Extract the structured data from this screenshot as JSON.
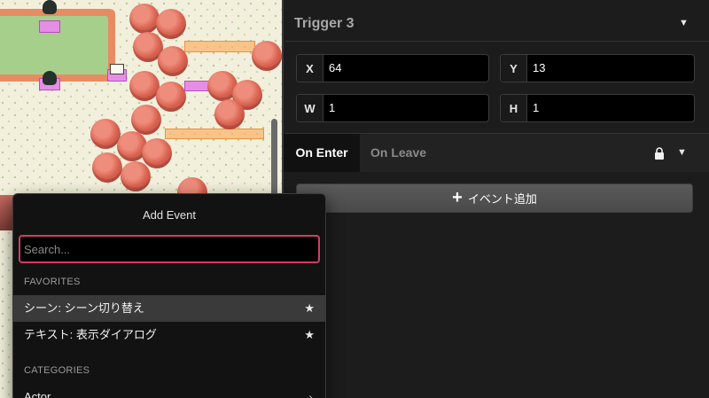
{
  "trigger": {
    "name": "Trigger 3",
    "fields": [
      {
        "label": "X",
        "value": "64"
      },
      {
        "label": "Y",
        "value": "13"
      },
      {
        "label": "W",
        "value": "1"
      },
      {
        "label": "H",
        "value": "1"
      }
    ]
  },
  "event_tabs": {
    "active": "On Enter",
    "inactive": "On Leave"
  },
  "add_event_button": {
    "label": "イベント追加"
  },
  "add_event_popup": {
    "title": "Add Event",
    "search_placeholder": "Search...",
    "favorites_label": "FAVORITES",
    "favorites": [
      {
        "label": "シーン: シーン切り替え",
        "highlighted": true
      },
      {
        "label": "テキスト: 表示ダイアログ",
        "highlighted": false
      }
    ],
    "categories_label": "CATEGORIES",
    "categories": [
      {
        "label": "Actor"
      }
    ]
  },
  "colors": {
    "accent": "#d23d68",
    "panel_bg": "#1c1c1c",
    "popup_bg": "#121212"
  }
}
